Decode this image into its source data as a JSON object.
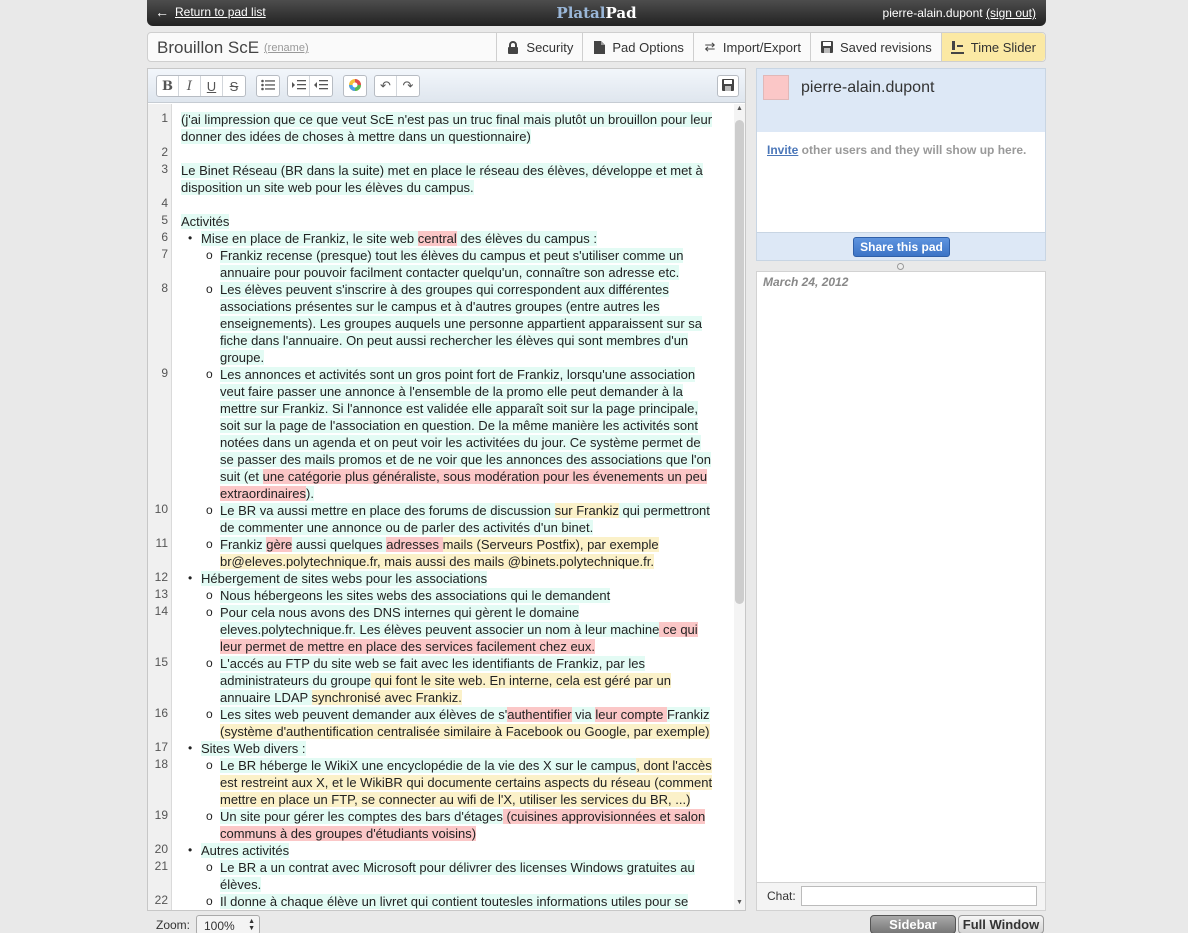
{
  "topbar": {
    "back_label": "Return to pad list",
    "logo_part1": "Platal",
    "logo_part2": "Pad",
    "username": "pierre-alain.dupont",
    "signout": "(sign out)"
  },
  "pad": {
    "title": "Brouillon ScE",
    "rename": "(rename)"
  },
  "tabs": [
    {
      "label": "Security"
    },
    {
      "label": "Pad Options"
    },
    {
      "label": "Import/Export"
    },
    {
      "label": "Saved revisions"
    },
    {
      "label": "Time Slider"
    }
  ],
  "toolbar": {
    "bold": "B",
    "italic": "I",
    "underline": "U",
    "strike": "S"
  },
  "editor": {
    "visual_lines": [
      {
        "n": "1",
        "level": 0,
        "segs": [
          [
            "(j'ai limpression que ce que veut ScE n'est pas un truc final mais plutôt un brouillon pour leur",
            "hl"
          ]
        ]
      },
      {
        "n": "",
        "level": 0,
        "segs": [
          [
            "donner des idées de choses à mettre dans un questionnaire)",
            "hl"
          ]
        ]
      },
      {
        "n": "2",
        "level": 0,
        "segs": []
      },
      {
        "n": "3",
        "level": 0,
        "segs": [
          [
            "Le Binet Réseau (BR dans la suite) met en place le réseau des élèves, développe et met à",
            "hl"
          ]
        ]
      },
      {
        "n": "",
        "level": 0,
        "segs": [
          [
            "disposition un site web pour les élèves du campus.",
            "hl"
          ]
        ]
      },
      {
        "n": "4",
        "level": 0,
        "segs": []
      },
      {
        "n": "5",
        "level": 0,
        "segs": [
          [
            "Activités",
            "hl"
          ]
        ]
      },
      {
        "n": "6",
        "level": 1,
        "bullet": "•",
        "segs": [
          [
            "Mise en place de Frankiz, le site web ",
            "hl"
          ],
          [
            "central",
            "a3"
          ],
          [
            " des élèves du campus :",
            "hl"
          ]
        ]
      },
      {
        "n": "7",
        "level": 2,
        "bullet": "o",
        "segs": [
          [
            "Frankiz recense (presque) tout les élèves du campus et peut s'utiliser comme un",
            "hl"
          ]
        ]
      },
      {
        "n": "",
        "level": 2,
        "segs": [
          [
            "annuaire pour pouvoir facilment contacter quelqu'un, connaître son adresse etc.",
            "hl"
          ]
        ]
      },
      {
        "n": "8",
        "level": 2,
        "bullet": "o",
        "segs": [
          [
            "Les élèves peuvent s'inscrire à des groupes qui correspondent aux différentes",
            "hl"
          ]
        ]
      },
      {
        "n": "",
        "level": 2,
        "segs": [
          [
            "associations présentes sur le campus et à d'autres groupes (entre autres les",
            "hl"
          ]
        ]
      },
      {
        "n": "",
        "level": 2,
        "segs": [
          [
            "enseignements). Les groupes auquels une personne appartient apparaissent sur sa",
            "hl"
          ]
        ]
      },
      {
        "n": "",
        "level": 2,
        "segs": [
          [
            "fiche dans l'annuaire. On peut aussi rechercher les élèves qui sont membres d'un",
            "hl"
          ]
        ]
      },
      {
        "n": "",
        "level": 2,
        "segs": [
          [
            "groupe.",
            "hl"
          ]
        ]
      },
      {
        "n": "9",
        "level": 2,
        "bullet": "o",
        "segs": [
          [
            "Les annonces et activités sont un gros point fort de Frankiz, lorsqu'une association",
            "hl"
          ]
        ]
      },
      {
        "n": "",
        "level": 2,
        "segs": [
          [
            "veut faire passer une annonce à l'ensemble de la promo elle peut demander à la",
            "hl"
          ]
        ]
      },
      {
        "n": "",
        "level": 2,
        "segs": [
          [
            "mettre sur Frankiz. Si l'annonce est validée elle apparaît soit sur la page principale,",
            "hl"
          ]
        ]
      },
      {
        "n": "",
        "level": 2,
        "segs": [
          [
            "soit sur la page de l'association en question. De la même manière les activités sont",
            "hl"
          ]
        ]
      },
      {
        "n": "",
        "level": 2,
        "segs": [
          [
            "notées dans un agenda et on peut voir les activitées du jour. Ce système permet de",
            "hl"
          ]
        ]
      },
      {
        "n": "",
        "level": 2,
        "segs": [
          [
            "se passer des mails promos et de ne voir que les annonces des associations que l'on",
            "hl"
          ]
        ]
      },
      {
        "n": "",
        "level": 2,
        "segs": [
          [
            "suit (et ",
            "hl"
          ],
          [
            "une catégorie plus généraliste, sous modération pour les évenements un peu",
            "a3"
          ]
        ]
      },
      {
        "n": "",
        "level": 2,
        "segs": [
          [
            "extraordinaires",
            "a3"
          ],
          [
            ").",
            "hl"
          ]
        ]
      },
      {
        "n": "10",
        "level": 2,
        "bullet": "o",
        "segs": [
          [
            "Le BR va aussi mettre en place des forums de discussion ",
            "hl"
          ],
          [
            "sur Frankiz",
            "a2"
          ],
          [
            " qui permettront",
            "hl"
          ]
        ]
      },
      {
        "n": "",
        "level": 2,
        "segs": [
          [
            "de commenter une annonce ou de parler des activités d'un binet.",
            "hl"
          ]
        ]
      },
      {
        "n": "11",
        "level": 2,
        "bullet": "o",
        "segs": [
          [
            "Frankiz ",
            "hl"
          ],
          [
            "gère",
            "a3"
          ],
          [
            " aussi quelques ",
            "hl"
          ],
          [
            "adresses ",
            "a3"
          ],
          [
            "mails (Serveurs Postfix), par exemple",
            "a2"
          ]
        ]
      },
      {
        "n": "",
        "level": 2,
        "segs": [
          [
            "br@eleves.polytechnique.fr, mais aussi des mails @binets.polytechnique.fr.",
            "a2"
          ]
        ]
      },
      {
        "n": "12",
        "level": 1,
        "bullet": "•",
        "segs": [
          [
            "Hébergement de sites webs pour les associations",
            "hl"
          ]
        ]
      },
      {
        "n": "13",
        "level": 2,
        "bullet": "o",
        "segs": [
          [
            "Nous hébergeons les sites webs des associations qui le demandent",
            "hl"
          ]
        ]
      },
      {
        "n": "14",
        "level": 2,
        "bullet": "o",
        "segs": [
          [
            "Pour cela nous avons des DNS internes qui gèrent le domaine",
            "hl"
          ]
        ]
      },
      {
        "n": "",
        "level": 2,
        "segs": [
          [
            "eleves.polytechnique.fr. Les élèves peuvent associer un nom à leur machine",
            "hl"
          ],
          [
            " ce qui",
            "a3"
          ]
        ]
      },
      {
        "n": "",
        "level": 2,
        "segs": [
          [
            "leur permet de mettre en place des services facilement chez eux.",
            "a3"
          ]
        ]
      },
      {
        "n": "15",
        "level": 2,
        "bullet": "o",
        "segs": [
          [
            "L'accés au FTP du site web se fait avec les identifiants de Frankiz, par les",
            "hl"
          ]
        ]
      },
      {
        "n": "",
        "level": 2,
        "segs": [
          [
            "administrateurs du groupe",
            "hl"
          ],
          [
            " qui font le site web. En interne, cela est géré par un",
            "a2"
          ]
        ]
      },
      {
        "n": "",
        "level": 2,
        "segs": [
          [
            "annuaire LDAP ",
            "hl"
          ],
          [
            "synchronisé avec Frankiz.",
            "a2"
          ]
        ]
      },
      {
        "n": "16",
        "level": 2,
        "bullet": "o",
        "segs": [
          [
            "Les sites web peuvent demander aux élèves de s'",
            "hl"
          ],
          [
            "authentifier",
            "a3"
          ],
          [
            " via ",
            "hl"
          ],
          [
            "leur compte ",
            "a3"
          ],
          [
            "Frankiz",
            "hl"
          ]
        ]
      },
      {
        "n": "",
        "level": 2,
        "segs": [
          [
            "(système d'authentification centralisée similaire à Facebook ou Google, par exemple)",
            "a2"
          ]
        ]
      },
      {
        "n": "17",
        "level": 1,
        "bullet": "•",
        "segs": [
          [
            "Sites Web divers :",
            "hl"
          ]
        ]
      },
      {
        "n": "18",
        "level": 2,
        "bullet": "o",
        "segs": [
          [
            "Le BR héberge le WikiX une encyclopédie de la vie des X sur le campus",
            "hl"
          ],
          [
            ", dont l'accès",
            "a2"
          ]
        ]
      },
      {
        "n": "",
        "level": 2,
        "segs": [
          [
            "est restreint aux X, et le WikiBR qui documente certains aspects du réseau (comment",
            "a2"
          ]
        ]
      },
      {
        "n": "",
        "level": 2,
        "segs": [
          [
            "mettre en place un FTP, se connecter au wifi de l'X, utiliser les services du BR, ...)",
            "a2"
          ]
        ]
      },
      {
        "n": "19",
        "level": 2,
        "bullet": "o",
        "segs": [
          [
            "Un site pour gérer les comptes des bars d'étages",
            "hl"
          ],
          [
            " (cuisines approvisionnées et salon",
            "a3"
          ]
        ]
      },
      {
        "n": "",
        "level": 2,
        "segs": [
          [
            "communs à des groupes d'étudiants voisins)",
            "a3"
          ]
        ]
      },
      {
        "n": "20",
        "level": 1,
        "bullet": "•",
        "segs": [
          [
            "Autres activités",
            "hl"
          ]
        ]
      },
      {
        "n": "21",
        "level": 2,
        "bullet": "o",
        "segs": [
          [
            "Le BR a un contrat avec Microsoft pour délivrer des licenses Windows gratuites au",
            "hl"
          ]
        ]
      },
      {
        "n": "",
        "level": 2,
        "segs": [
          [
            "élèves.",
            "hl"
          ]
        ]
      },
      {
        "n": "22",
        "level": 2,
        "bullet": "o",
        "segs": [
          [
            "Il donne à chaque élève un livret qui contient toutesles informations utiles pour se",
            "hl"
          ]
        ]
      }
    ]
  },
  "zoom": {
    "label": "Zoom:",
    "value": "100%"
  },
  "sidebar": {
    "user_name": "pierre-alain.dupont",
    "user_color": "#fbc7c7",
    "invite_link": "Invite",
    "invite_text": " other users and they will show up here.",
    "share_button": "Share this pad",
    "revision_date": "March 24, 2012",
    "chat_label": "Chat:",
    "chat_placeholder": ""
  },
  "footer": {
    "sidebar_button": "Sidebar",
    "fullwindow_button": "Full Window"
  },
  "colors": {
    "author_self": "#e3fbf4",
    "author_2": "#fbf1c9",
    "author_3": "#fbc7c7",
    "active_tab": "#fbe9a4"
  }
}
